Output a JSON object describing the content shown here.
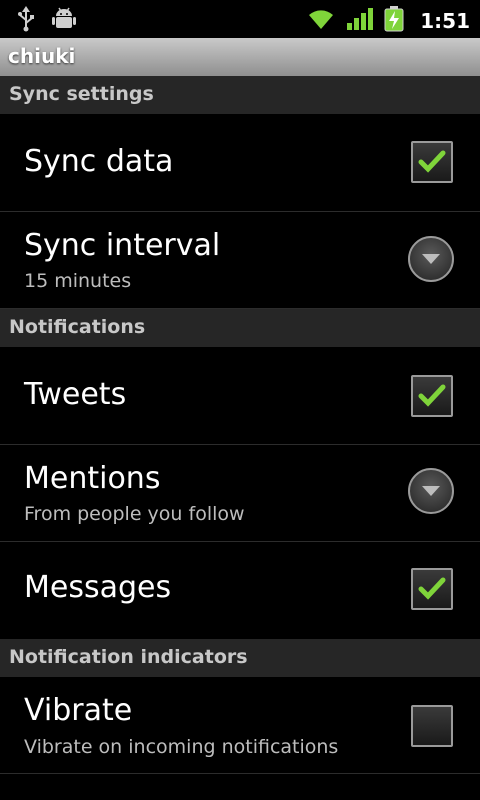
{
  "status_bar": {
    "time": "1:51",
    "icons": [
      "usb-icon",
      "android-debug-icon",
      "wifi-icon",
      "signal-icon",
      "battery-charging-icon"
    ]
  },
  "app": {
    "title": "chiuki"
  },
  "sections": [
    {
      "header": "Sync settings",
      "items": [
        {
          "title": "Sync data",
          "control": "checkbox",
          "checked": true
        },
        {
          "title": "Sync interval",
          "summary": "15 minutes",
          "control": "dropdown"
        }
      ]
    },
    {
      "header": "Notifications",
      "items": [
        {
          "title": "Tweets",
          "control": "checkbox",
          "checked": true
        },
        {
          "title": "Mentions",
          "summary": "From people you follow",
          "control": "dropdown"
        },
        {
          "title": "Messages",
          "control": "checkbox",
          "checked": true
        }
      ]
    },
    {
      "header": "Notification indicators",
      "items": [
        {
          "title": "Vibrate",
          "summary": "Vibrate on incoming notifications",
          "control": "checkbox",
          "checked": false
        }
      ]
    }
  ],
  "colors": {
    "check": "#7fd43a",
    "section_bg": "#262626",
    "title_bar": "#a8a8a8"
  }
}
